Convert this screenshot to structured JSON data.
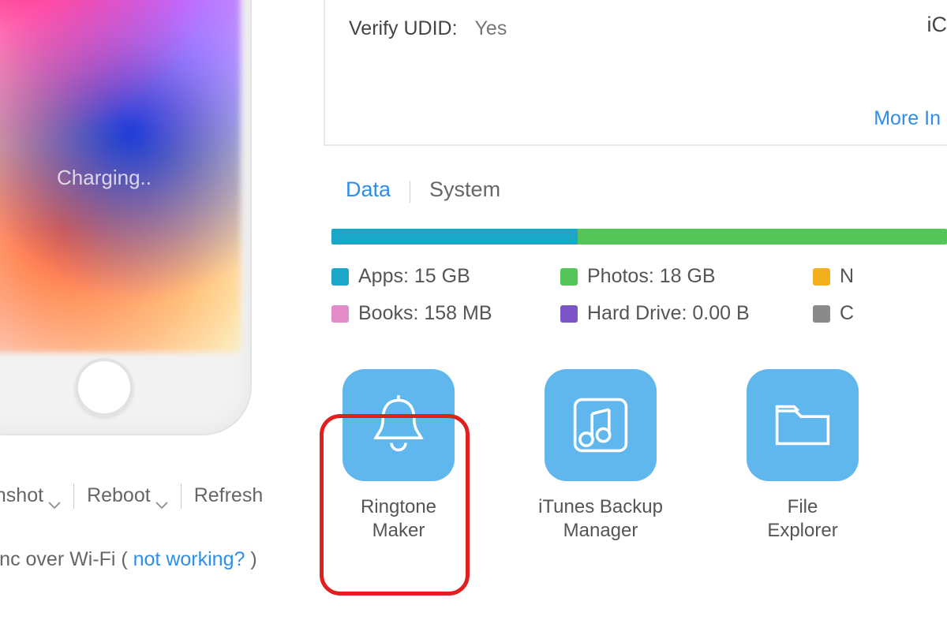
{
  "device": {
    "status_text": "Charging..",
    "actions": {
      "screenshot_label": "enshot",
      "reboot_label": "Reboot",
      "refresh_label": "Refresh"
    },
    "wifi_sync": {
      "prefix": "Sync over Wi-Fi ( ",
      "link": "not working?",
      "suffix": " )"
    }
  },
  "info_panel": {
    "verify_udid_label": "Verify UDID:",
    "verify_udid_value": "Yes",
    "right_cut_text": "iC",
    "more_link": "More In"
  },
  "tabs": {
    "data": "Data",
    "system": "System"
  },
  "storage": {
    "segments": [
      {
        "color": "#1aa7c8",
        "pct": 40
      },
      {
        "color": "#55c559",
        "pct": 60
      }
    ],
    "legend": [
      {
        "color": "#1aa7c8",
        "label": "Apps: 15 GB"
      },
      {
        "color": "#55c559",
        "label": "Photos: 18 GB"
      },
      {
        "color": "#f2b01e",
        "label": "N"
      },
      {
        "color": "#e38cc9",
        "label": "Books: 158 MB"
      },
      {
        "color": "#7b54c7",
        "label": "Hard Drive: 0.00 B"
      },
      {
        "color": "#8a8a8a",
        "label": "C"
      }
    ]
  },
  "tools": {
    "ringtone": "Ringtone\nMaker",
    "itunes": "iTunes Backup\nManager",
    "explorer": "File\nExplorer"
  },
  "colors": {
    "accent": "#2f8eea",
    "tile": "#5fb7ee",
    "highlight": "#e02020"
  }
}
